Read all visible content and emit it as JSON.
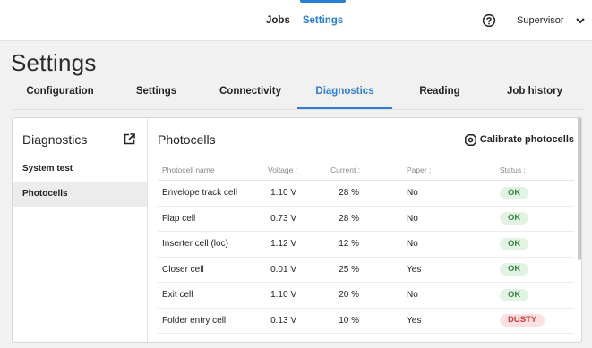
{
  "topnav": {
    "jobs": "Jobs",
    "settings": "Settings"
  },
  "user": {
    "name": "Supervisor"
  },
  "page": {
    "title": "Settings"
  },
  "tabs": [
    {
      "label": "Configuration"
    },
    {
      "label": "Settings"
    },
    {
      "label": "Connectivity"
    },
    {
      "label": "Diagnostics"
    },
    {
      "label": "Reading"
    },
    {
      "label": "Job history"
    }
  ],
  "sidebar": {
    "title": "Diagnostics",
    "items": [
      {
        "label": "System test"
      },
      {
        "label": "Photocells"
      }
    ]
  },
  "content": {
    "title": "Photocells",
    "calibrate_label": "Calibrate photocells",
    "columns": [
      "Photocell name",
      "Voltage :",
      "Current :",
      "Paper :",
      "Status :"
    ],
    "rows": [
      {
        "name": "Envelope track cell",
        "voltage": "1.10 V",
        "current": "28 %",
        "paper": "No",
        "status": "OK"
      },
      {
        "name": "Flap cell",
        "voltage": "0.73 V",
        "current": "28 %",
        "paper": "No",
        "status": "OK"
      },
      {
        "name": "Inserter cell (loc)",
        "voltage": "1.12 V",
        "current": "12 %",
        "paper": "No",
        "status": "OK"
      },
      {
        "name": "Closer cell",
        "voltage": "0.01 V",
        "current": "25 %",
        "paper": "Yes",
        "status": "OK"
      },
      {
        "name": "Exit cell",
        "voltage": "1.10 V",
        "current": "20 %",
        "paper": "No",
        "status": "OK"
      },
      {
        "name": "Folder entry cell",
        "voltage": "0.13 V",
        "current": "10 %",
        "paper": "Yes",
        "status": "DUSTY"
      }
    ]
  },
  "colors": {
    "accent": "#2a7fd4",
    "ok": "#2c8a3b",
    "dusty": "#d03b3b"
  }
}
